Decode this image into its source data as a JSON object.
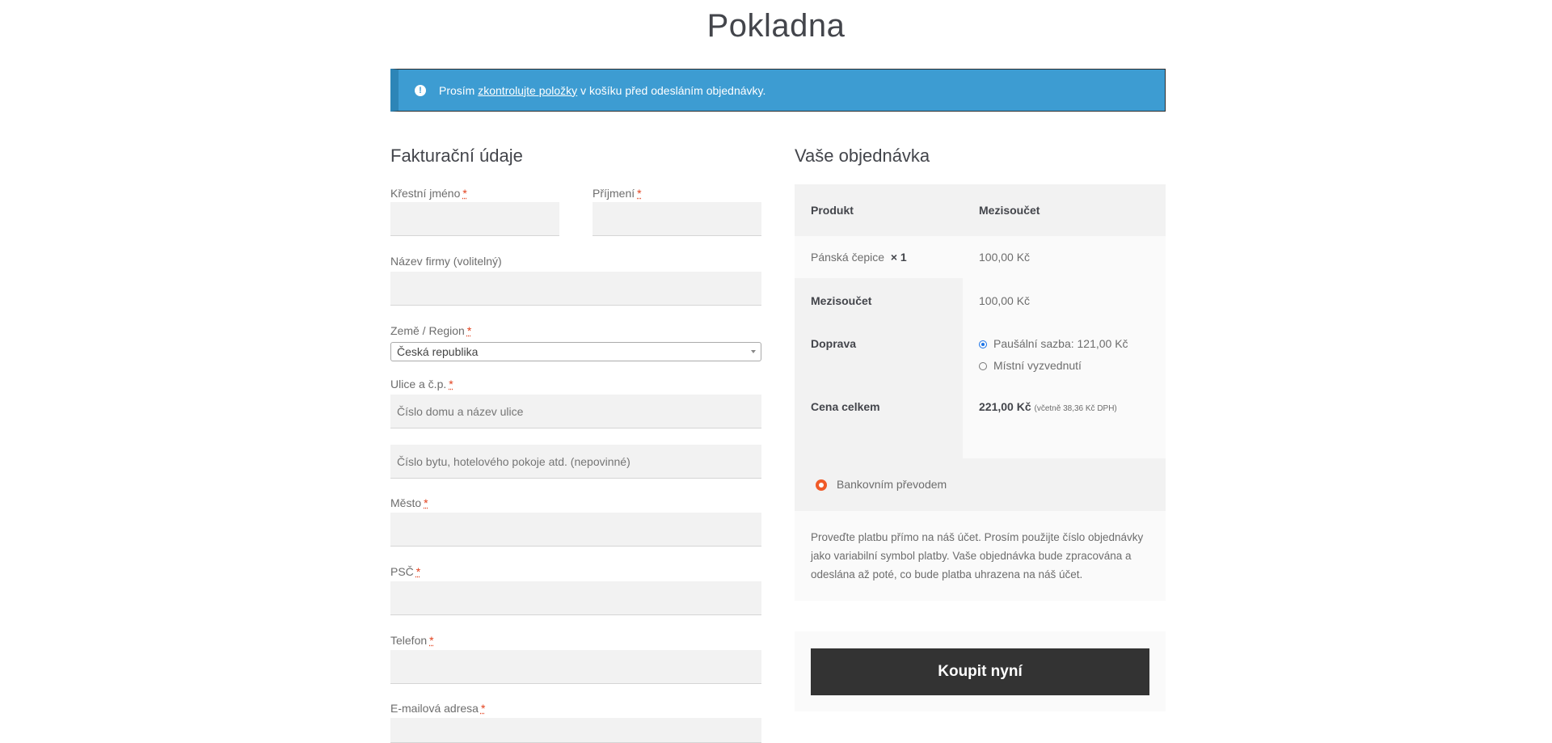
{
  "page_title": "Pokladna",
  "notice": {
    "prefix": "Prosím ",
    "link": "zkontrolujte položky",
    "suffix": " v košíku před odesláním objednávky."
  },
  "billing": {
    "heading": "Fakturační údaje",
    "required_mark": "*",
    "first_name_label": "Křestní jméno",
    "last_name_label": "Příjmení",
    "company_label": "Název firmy (volitelný)",
    "country_label": "Země / Region",
    "country_value": "Česká republika",
    "street_label": "Ulice a č.p.",
    "street_placeholder": "Číslo domu a název ulice",
    "street2_placeholder": "Číslo bytu, hotelového pokoje atd. (nepovinné)",
    "city_label": "Město",
    "zip_label": "PSČ",
    "phone_label": "Telefon",
    "email_label": "E-mailová adresa"
  },
  "order": {
    "heading": "Vaše objednávka",
    "col_product": "Produkt",
    "col_subtotal": "Mezisoučet",
    "item_name": "Pánská čepice",
    "item_qty": "× 1",
    "item_price": "100,00 Kč",
    "subtotal_label": "Mezisoučet",
    "subtotal_value": "100,00 Kč",
    "shipping_label": "Doprava",
    "shipping_options": [
      {
        "label": "Paušální sazba: 121,00 Kč",
        "checked": true
      },
      {
        "label": "Místní vyzvednutí",
        "checked": false
      }
    ],
    "total_label": "Cena celkem",
    "total_value": "221,00 Kč",
    "total_tax": "(včetně 38,36 Kč DPH)"
  },
  "payment": {
    "method_label": "Bankovním převodem",
    "description": "Proveďte platbu přímo na náš účet. Prosím použijte číslo objednávky jako variabilní symbol platby. Vaše objednávka bude zpracována a odeslána až poté, co bude platba uhrazena na náš účet."
  },
  "buy_button_label": "Koupit nyní",
  "colors": {
    "notice_bg": "#3d9cd2",
    "required": "#e2401c",
    "payment_radio": "#f05a28",
    "button_bg": "#333333"
  }
}
